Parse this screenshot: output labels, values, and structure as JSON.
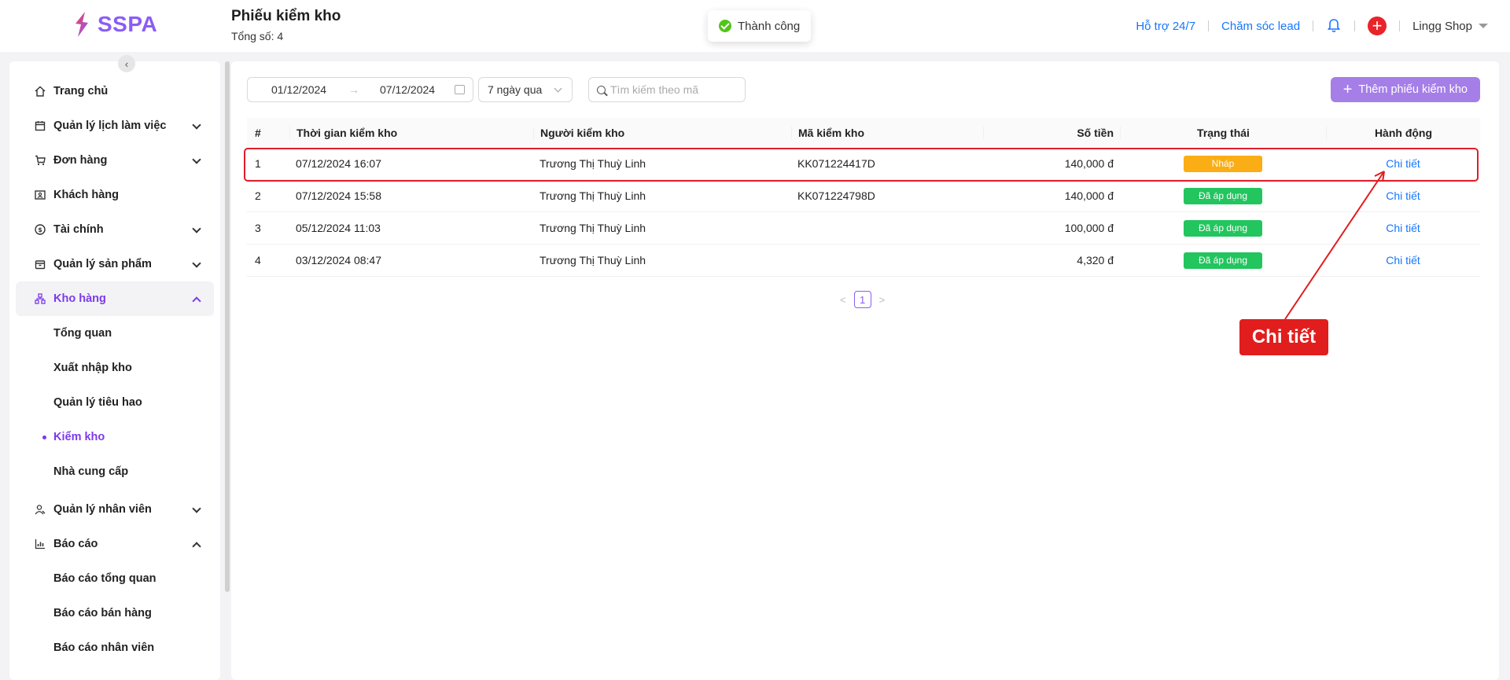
{
  "header": {
    "logo_text": "SSPA",
    "title": "Phiếu kiểm kho",
    "subtitle": "Tổng số: 4",
    "toast": "Thành công",
    "links": [
      "Hỗ trợ 24/7",
      "Chăm sóc lead"
    ],
    "shop_name": "Lingg Shop"
  },
  "sidebar": {
    "items": [
      {
        "label": "Trang chủ",
        "icon": "home-icon"
      },
      {
        "label": "Quản lý lịch làm việc",
        "icon": "calendar-icon"
      },
      {
        "label": "Đơn hàng",
        "icon": "cart-icon"
      },
      {
        "label": "Khách hàng",
        "icon": "customer-icon"
      },
      {
        "label": "Tài chính",
        "icon": "dollar-icon"
      },
      {
        "label": "Quản lý sản phẩm",
        "icon": "box-icon"
      },
      {
        "label": "Kho hàng",
        "icon": "warehouse-icon"
      },
      {
        "label": "Quản lý nhân viên",
        "icon": "staff-icon"
      },
      {
        "label": "Báo cáo",
        "icon": "chart-icon"
      }
    ],
    "warehouse_sub": [
      "Tổng quan",
      "Xuất nhập kho",
      "Quản lý tiêu hao",
      "Kiểm kho",
      "Nhà cung cấp"
    ],
    "report_sub": [
      "Báo cáo tổng quan",
      "Báo cáo bán hàng",
      "Báo cáo nhân viên"
    ]
  },
  "filters": {
    "date_from": "01/12/2024",
    "date_arrow": "→",
    "date_to": "07/12/2024",
    "range_select": "7 ngày qua",
    "search_placeholder": "Tìm kiếm theo mã",
    "add_button": "Thêm phiếu kiểm kho"
  },
  "table": {
    "columns": [
      "#",
      "Thời gian kiểm kho",
      "Người kiểm kho",
      "Mã kiểm kho",
      "Số tiền",
      "Trạng thái",
      "Hành động"
    ],
    "rows": [
      {
        "idx": "1",
        "time": "07/12/2024 16:07",
        "person": "Trương Thị Thuỳ Linh",
        "code": "KK071224417D",
        "amount": "140,000 đ",
        "status": "Nháp",
        "action": "Chi tiết"
      },
      {
        "idx": "2",
        "time": "07/12/2024 15:58",
        "person": "Trương Thị Thuỳ Linh",
        "code": "KK071224798D",
        "amount": "140,000 đ",
        "status": "Đã áp dụng",
        "action": "Chi tiết"
      },
      {
        "idx": "3",
        "time": "05/12/2024 11:03",
        "person": "Trương Thị Thuỳ Linh",
        "code": "",
        "amount": "100,000 đ",
        "status": "Đã áp dụng",
        "action": "Chi tiết"
      },
      {
        "idx": "4",
        "time": "03/12/2024 08:47",
        "person": "Trương Thị Thuỳ Linh",
        "code": "",
        "amount": "4,320 đ",
        "status": "Đã áp dụng",
        "action": "Chi tiết"
      }
    ]
  },
  "pagination": {
    "prev": "<",
    "current": "1",
    "next": ">"
  },
  "annotation": {
    "callout": "Chi tiết",
    "color": "#e11d1d"
  },
  "colors": {
    "brand": "#8b5cf6",
    "link": "#1677ff",
    "draft": "#faad14",
    "applied": "#22c55e"
  }
}
